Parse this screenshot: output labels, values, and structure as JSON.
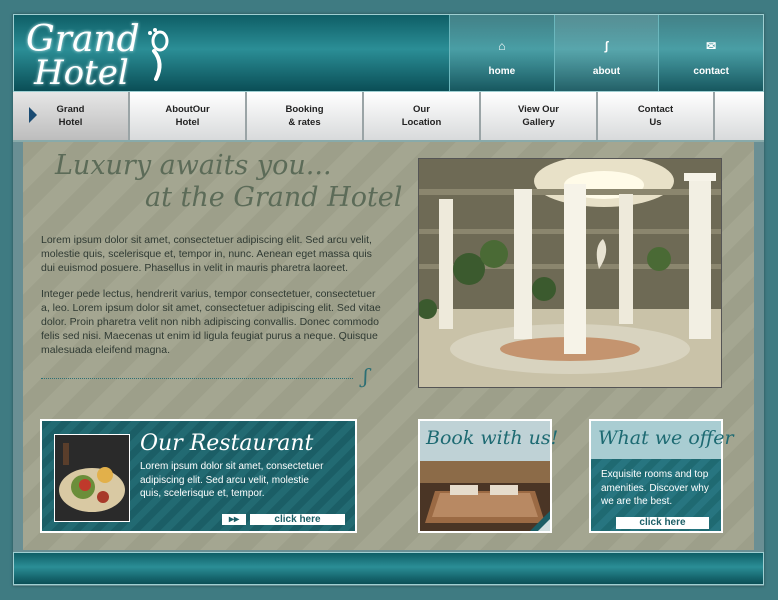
{
  "logo": {
    "line1": "Grand",
    "line2": "Hotel"
  },
  "top_nav": [
    {
      "label": "home",
      "icon": "home-icon"
    },
    {
      "label": "about",
      "icon": "footprint-icon"
    },
    {
      "label": "contact",
      "icon": "envelope-icon"
    }
  ],
  "menu": [
    {
      "line1": "Grand",
      "line2": "Hotel"
    },
    {
      "line1": "AboutOur",
      "line2": "Hotel"
    },
    {
      "line1": "Booking",
      "line2": "& rates"
    },
    {
      "line1": "Our",
      "line2": "Location"
    },
    {
      "line1": "View Our",
      "line2": "Gallery"
    },
    {
      "line1": "Contact",
      "line2": "Us"
    }
  ],
  "main": {
    "headline1": "Luxury awaits you...",
    "headline2": "at the Grand Hotel",
    "para1": "Lorem ipsum dolor sit amet, consectetuer adipiscing elit. Sed arcu velit, molestie quis, scelerisque et, tempor in, nunc. Aenean eget massa quis dui euismod posuere. Phasellus in velit in mauris pharetra laoreet.",
    "para2": "Integer pede lectus, hendrerit varius, tempor consectetuer, consectetuer a, leo. Lorem ipsum dolor sit amet, consectetuer adipiscing elit. Sed vitae dolor. Proin pharetra velit non nibh adipiscing convallis. Donec commodo felis sed nisi. Maecenas ut enim id ligula feugiat purus a neque. Quisque malesuada eleifend magna."
  },
  "restaurant": {
    "title": "Our Restaurant",
    "body": "Lorem ipsum dolor sit amet, consectetuer adipiscing elit. Sed arcu velit, molestie quis, scelerisque et, tempor.",
    "button": "click here"
  },
  "booking": {
    "title": "Book with us!"
  },
  "offer": {
    "title": "What we offer",
    "body": "Exquisite rooms and top amenities. Discover why we are the best.",
    "button": "click here"
  },
  "colors": {
    "teal": "#1b5e66",
    "menu_arrow": "#1a4b72",
    "headline": "#5c6b58"
  }
}
